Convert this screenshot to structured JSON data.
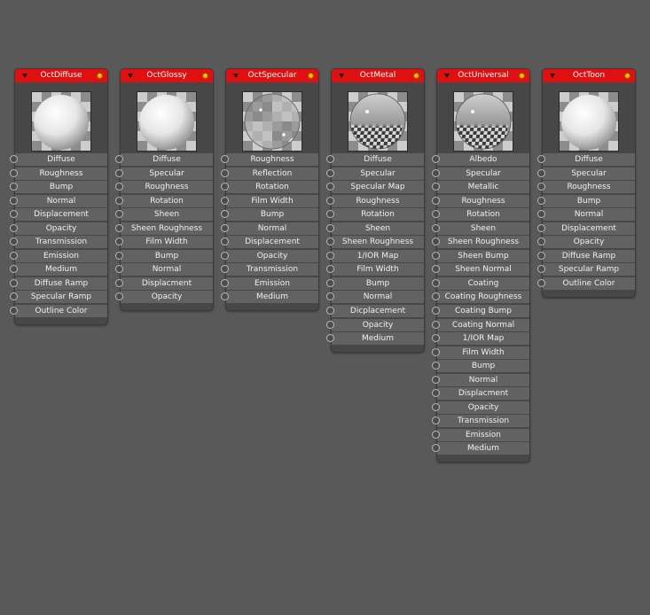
{
  "nodes": [
    {
      "title": "OctDiffuse",
      "preview": "diffuse-sphere",
      "ports": [
        "Diffuse",
        "Roughness",
        "Bump",
        "Normal",
        "Displacement",
        "Opacity",
        "Transmission",
        "Emission",
        "Medium",
        "Diffuse Ramp",
        "Specular Ramp",
        "Outline Color"
      ]
    },
    {
      "title": "OctGlossy",
      "preview": "glossy-sphere",
      "ports": [
        "Diffuse",
        "Specular",
        "Roughness",
        "Rotation",
        "Sheen",
        "Sheen Roughness",
        "Film Width",
        "Bump",
        "Normal",
        "Displacment",
        "Opacity"
      ]
    },
    {
      "title": "OctSpecular",
      "preview": "specular-sphere",
      "ports": [
        "Roughness",
        "Reflection",
        "Rotation",
        "Film Width",
        "Bump",
        "Normal",
        "Displacement",
        "Opacity",
        "Transmission",
        "Emission",
        "Medium"
      ]
    },
    {
      "title": "OctMetal",
      "preview": "metal-sphere",
      "ports": [
        "Diffuse",
        "Specular",
        "Specular Map",
        "Roughness",
        "Rotation",
        "Sheen",
        "Sheen Roughness",
        "1/IOR Map",
        "Film Width",
        "Bump",
        "Normal",
        "Dicplacement",
        "Opacity",
        "Medium"
      ]
    },
    {
      "title": "OctUniversal",
      "preview": "metal-sphere",
      "ports": [
        "Albedo",
        "Specular",
        "Metallic",
        "Roughness",
        "Rotation",
        "Sheen",
        "Sheen Roughness",
        "Sheen Bump",
        "Sheen Normal",
        "Coating",
        "Coating Roughness",
        "Coating Bump",
        "Coating Normal",
        "1/IOR Map",
        "Film Width",
        "Bump",
        "Normal",
        "Displacment",
        "Opacity",
        "Transmission",
        "Emission",
        "Medium"
      ]
    },
    {
      "title": "OctToon",
      "preview": "toon-sphere",
      "ports": [
        "Diffuse",
        "Specular",
        "Roughness",
        "Bump",
        "Normal",
        "Displacement",
        "Opacity",
        "Diffuse Ramp",
        "Specular Ramp",
        "Outline Color"
      ]
    }
  ],
  "colors": {
    "canvas": "#595959",
    "node_body": "#474747",
    "header": "#e01010",
    "status_dot": "#f5b400",
    "port_row": "#626262"
  }
}
